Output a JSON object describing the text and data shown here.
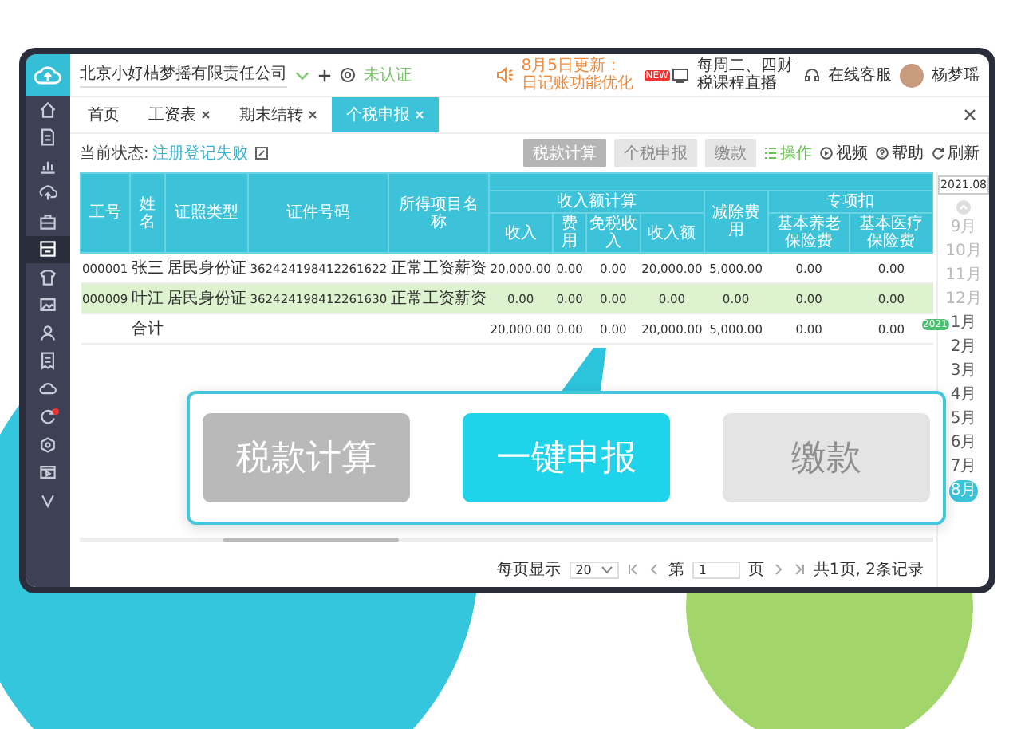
{
  "topbar": {
    "company": "北京小好桔梦摇有限责任公司",
    "auth_status": "未认证",
    "notice": "8月5日更新：日记账功能优化",
    "live_badge": "NEW",
    "live": "每周二、四财税课程直播",
    "service": "在线客服",
    "user": "杨梦瑶"
  },
  "sidebar": {
    "items": [
      {
        "selected": false,
        "alert": false
      },
      {
        "selected": false,
        "alert": false
      },
      {
        "selected": false,
        "alert": false
      },
      {
        "selected": false,
        "alert": false
      },
      {
        "selected": false,
        "alert": false
      },
      {
        "selected": true,
        "alert": false
      },
      {
        "selected": false,
        "alert": false
      },
      {
        "selected": false,
        "alert": false
      },
      {
        "selected": false,
        "alert": false
      },
      {
        "selected": false,
        "alert": false
      },
      {
        "selected": false,
        "alert": false
      },
      {
        "selected": false,
        "alert": true
      },
      {
        "selected": false,
        "alert": false
      },
      {
        "selected": false,
        "alert": false
      },
      {
        "selected": false,
        "alert": false
      }
    ]
  },
  "tabs": [
    {
      "label": "首页",
      "closable": false,
      "selected": false
    },
    {
      "label": "工资表",
      "closable": true,
      "selected": false
    },
    {
      "label": "期末结转",
      "closable": true,
      "selected": false
    },
    {
      "label": "个税申报",
      "closable": true,
      "selected": true
    }
  ],
  "toolbar": {
    "status_label": "当前状态:",
    "status_value": "注册登记失败",
    "buttons": [
      {
        "label": "税款计算",
        "disabled": false
      },
      {
        "label": "个税申报",
        "disabled": true
      },
      {
        "label": "缴款",
        "disabled": true
      }
    ],
    "links": [
      {
        "kind": "operate",
        "label": "操作"
      },
      {
        "kind": "video",
        "label": "视频"
      },
      {
        "kind": "help",
        "label": "帮助"
      },
      {
        "kind": "refresh",
        "label": "刷新"
      }
    ]
  },
  "table": {
    "columns": [
      {
        "label": "工号"
      },
      {
        "label": "姓名"
      },
      {
        "label": "证照类型"
      },
      {
        "label": "证件号码"
      },
      {
        "label": "所得项目名称"
      },
      {
        "label": "收入额计算",
        "colspan": 4,
        "children": [
          {
            "label": "收入"
          },
          {
            "label": "费用"
          },
          {
            "label": "免税收入"
          },
          {
            "label": "收入额"
          }
        ]
      },
      {
        "label": "减除费用"
      },
      {
        "label": "专项扣",
        "colspan": 2,
        "children": [
          {
            "label": "基本养老保险费"
          },
          {
            "label": "基本医疗保险费"
          }
        ]
      }
    ],
    "rows": [
      {
        "selected": false,
        "cells": [
          "000001",
          "张三",
          "居民身份证",
          "362424198412261622",
          "正常工资薪资",
          "20,000.00",
          "0.00",
          "0.00",
          "20,000.00",
          "5,000.00",
          "0.00",
          "0.00"
        ]
      },
      {
        "selected": true,
        "cells": [
          "000009",
          "叶江",
          "居民身份证",
          "362424198412261630",
          "正常工资薪资",
          "0.00",
          "0.00",
          "0.00",
          "0.00",
          "0.00",
          "0.00",
          "0.00"
        ]
      },
      {
        "selected": false,
        "cells": [
          "",
          "合计",
          "",
          "",
          "",
          "20,000.00",
          "0.00",
          "0.00",
          "20,000.00",
          "5,000.00",
          "0.00",
          "0.00"
        ]
      }
    ]
  },
  "periods": {
    "value": "2021.08",
    "months": [
      {
        "label": "9月",
        "disabled": true,
        "selected": false
      },
      {
        "label": "10月",
        "disabled": true,
        "selected": false
      },
      {
        "label": "11月",
        "disabled": true,
        "selected": false
      },
      {
        "label": "12月",
        "disabled": true,
        "selected": false
      },
      {
        "label": "1月",
        "disabled": false,
        "selected": false,
        "year_tag": "2021"
      },
      {
        "label": "2月",
        "disabled": false,
        "selected": false
      },
      {
        "label": "3月",
        "disabled": false,
        "selected": false
      },
      {
        "label": "4月",
        "disabled": false,
        "selected": false
      },
      {
        "label": "5月",
        "disabled": false,
        "selected": false
      },
      {
        "label": "6月",
        "disabled": false,
        "selected": false
      },
      {
        "label": "7月",
        "disabled": false,
        "selected": false
      },
      {
        "label": "8月",
        "disabled": false,
        "selected": true
      }
    ]
  },
  "pagination": {
    "page_size_label": "每页显示",
    "page_size": "20",
    "page_prefix": "第",
    "page": "1",
    "page_suffix": "页",
    "summary": "共1页, 2条记录"
  },
  "callout": {
    "buttons": [
      {
        "label": "税款计算",
        "highlighted": false,
        "disabled": false
      },
      {
        "label": "一键申报",
        "highlighted": true,
        "disabled": false
      },
      {
        "label": "缴款",
        "highlighted": false,
        "disabled": true
      }
    ]
  }
}
